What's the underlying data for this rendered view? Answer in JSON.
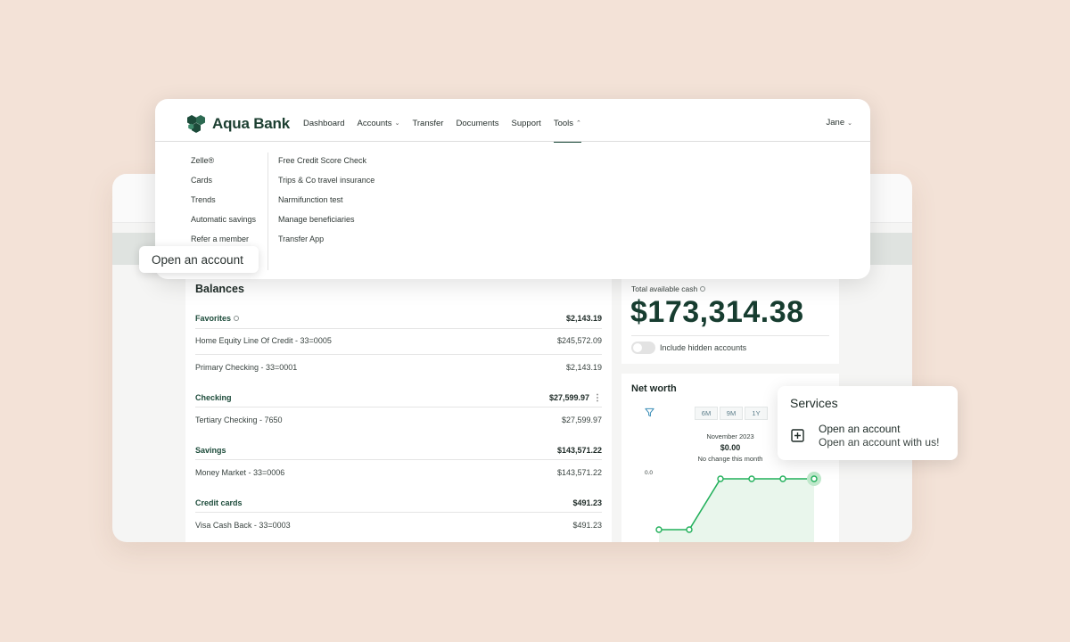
{
  "brand": {
    "name": "Aqua Bank",
    "primary_color": "#173d30",
    "accent_green": "#1fb25a"
  },
  "nav": {
    "items": [
      {
        "label": "Dashboard"
      },
      {
        "label": "Accounts"
      },
      {
        "label": "Transfer"
      },
      {
        "label": "Documents"
      },
      {
        "label": "Support"
      },
      {
        "label": "Tools"
      }
    ],
    "active": "Tools",
    "user": "Jane"
  },
  "tools_menu": {
    "col1": [
      "Zelle®",
      "Cards",
      "Trends",
      "Automatic savings",
      "Refer a member"
    ],
    "col2": [
      "Free Credit Score Check",
      "Trips & Co travel insurance",
      "Narmifunction test",
      "Manage beneficiaries",
      "Transfer App"
    ]
  },
  "tooltip": {
    "label": "Open an account"
  },
  "balances": {
    "title": "Balances",
    "groups": [
      {
        "name": "Favorites",
        "total": "$2,143.19",
        "rows": [
          {
            "name": "Home Equity Line Of Credit - 33=0005",
            "amount": "$245,572.09"
          },
          {
            "name": "Primary Checking - 33=0001",
            "amount": "$2,143.19"
          }
        ]
      },
      {
        "name": "Checking",
        "total": "$27,599.97",
        "rows": [
          {
            "name": "Tertiary Checking - 7650",
            "amount": "$27,599.97"
          }
        ]
      },
      {
        "name": "Savings",
        "total": "$143,571.22",
        "rows": [
          {
            "name": "Money Market - 33=0006",
            "amount": "$143,571.22"
          }
        ]
      },
      {
        "name": "Credit cards",
        "total": "$491.23",
        "rows": [
          {
            "name": "Visa Cash Back - 33=0003",
            "amount": "$491.23"
          }
        ]
      }
    ]
  },
  "cash": {
    "label": "Total available cash",
    "value": "$173,314.38",
    "toggle_label": "Include hidden accounts",
    "toggle_on": false
  },
  "net_worth": {
    "title": "Net worth",
    "ranges": [
      "6M",
      "9M",
      "1Y"
    ],
    "selected_month": "November 2023",
    "amount": "$0.00",
    "change": "No change this month",
    "y_tick": "0.0"
  },
  "services": {
    "title": "Services",
    "item_title": "Open an account",
    "item_subtitle": "Open an account with us!"
  }
}
